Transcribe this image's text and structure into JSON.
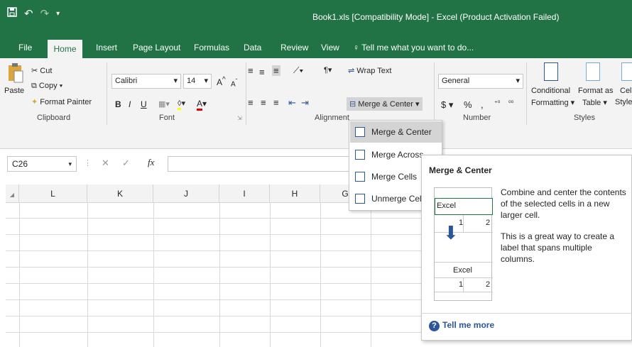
{
  "window": {
    "title": "Book1.xls  [Compatibility Mode] - Excel (Product Activation Failed)"
  },
  "tabs": [
    "File",
    "Home",
    "Insert",
    "Page Layout",
    "Formulas",
    "Data",
    "Review",
    "View"
  ],
  "tell_me": "Tell me what you want to do...",
  "clipboard": {
    "paste": "Paste",
    "cut": "Cut",
    "copy": "Copy",
    "format_painter": "Format Painter",
    "label": "Clipboard"
  },
  "font": {
    "name": "Calibri",
    "size": "14",
    "label": "Font"
  },
  "alignment": {
    "wrap_text": "Wrap Text",
    "merge_center": "Merge & Center",
    "label": "Alignment"
  },
  "number": {
    "format": "General",
    "label": "Number"
  },
  "styles": {
    "conditional_1": "Conditional",
    "conditional_2": "Formatting",
    "format_as_1": "Format as",
    "format_as_2": "Table",
    "cell_1": "Cell",
    "cell_2": "Styles",
    "label": "Styles"
  },
  "namebox": "C26",
  "fx": "fx",
  "columns": [
    "L",
    "K",
    "J",
    "I",
    "H",
    "G"
  ],
  "merge_menu": [
    {
      "label": "Merge & Center"
    },
    {
      "label": "Merge Across"
    },
    {
      "label": "Merge Cells"
    },
    {
      "label": "Unmerge Cells"
    }
  ],
  "tooltip": {
    "title": "Merge & Center",
    "desc1": "Combine and center the contents of the selected cells in a new larger cell.",
    "desc2": "This is a great way to create a label that spans multiple columns.",
    "illus_top_text": "Excel",
    "illus_top_n1": "1",
    "illus_top_n2": "2",
    "illus_bottom_text": "Excel",
    "illus_bottom_n1": "1",
    "illus_bottom_n2": "2",
    "tell_more": "Tell me more"
  },
  "colors": {
    "accent": "#217346",
    "link": "#2b579a"
  }
}
